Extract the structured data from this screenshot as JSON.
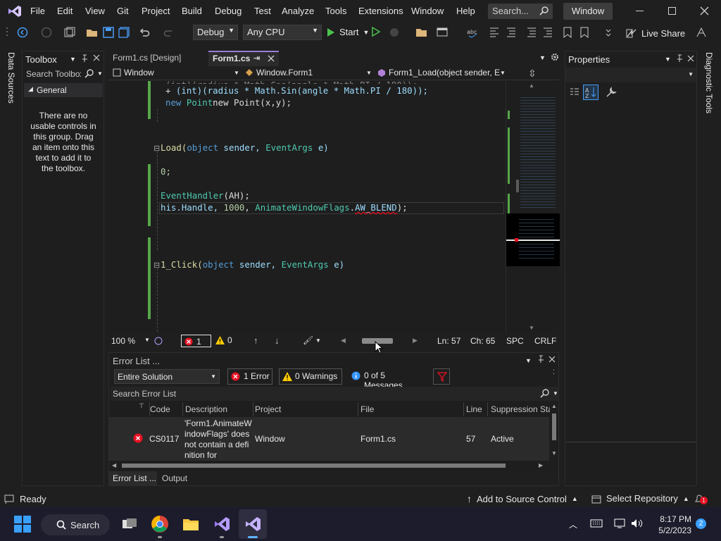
{
  "menu": [
    "File",
    "Edit",
    "View",
    "Git",
    "Project",
    "Build",
    "Debug",
    "Test",
    "Analyze",
    "Tools",
    "Extensions",
    "Window",
    "Help"
  ],
  "search": {
    "placeholder": "Search..."
  },
  "window_title": "Window",
  "toolbar": {
    "config": "Debug",
    "platform": "Any CPU",
    "start_label": "Start",
    "live_share": "Live Share"
  },
  "toolbox": {
    "title": "Toolbox",
    "search_placeholder": "Search Toolbox",
    "group": "General",
    "empty_text": "There are no usable controls in this group. Drag an item onto this text to add it to the toolbox."
  },
  "side_tabs": {
    "left": "Data Sources",
    "right": "Diagnostic Tools"
  },
  "tabs": [
    {
      "label": "Form1.cs [Design]"
    },
    {
      "label": "Form1.cs"
    }
  ],
  "nav": {
    "project": "Window",
    "class": "Window.Form1",
    "member": "Form1_Load(object sender, E"
  },
  "code": {
    "line1": "(int)(radius * Math.Sin(angle * Math.PI / 180));",
    "line2": "new Point(x,y);",
    "line3a": "Load(",
    "line3b": "object",
    "line3c": " sender, ",
    "line3d": "EventArgs",
    "line3e": " e)",
    "line4": "0;",
    "line5a": "EventHandler",
    "line5b": "(AH);",
    "line6a": "his.Handle, ",
    "line6b": "1000",
    "line6c": ", ",
    "line6d": "AnimateWindowFlags",
    "line6e": ".",
    "line6f": "AW_BLEND",
    "line6g": ");",
    "line7a": "1_Click(",
    "line7b": "object",
    "line7c": " sender, ",
    "line7d": "EventArgs",
    "line7e": " e)"
  },
  "status_editor": {
    "zoom": "100 %",
    "errors": "1",
    "warnings": "0",
    "ln": "Ln: 57",
    "ch": "Ch: 65",
    "spc": "SPC",
    "crlf": "CRLF"
  },
  "properties": {
    "title": "Properties"
  },
  "error_list": {
    "title": "Error List ...",
    "scope": "Entire Solution",
    "errors_btn": "1 Error",
    "warnings_btn": "0 Warnings",
    "messages_btn": "0 of 5 Messages",
    "search_placeholder": "Search Error List",
    "columns": [
      "Code",
      "Description",
      "Project",
      "File",
      "Line",
      "Suppression Sta"
    ],
    "row": {
      "code": "CS0117",
      "description": "'Form1.AnimateWindowFlags' does not contain a definition for",
      "project": "Window",
      "file": "Form1.cs",
      "line": "57",
      "suppression": "Active"
    },
    "bottom_tabs": [
      "Error List ...",
      "Output"
    ]
  },
  "statusbar": {
    "ready": "Ready",
    "source_control": "Add to Source Control",
    "repository": "Select Repository",
    "notifications": "1"
  },
  "taskbar": {
    "search": "Search",
    "time": "8:17 PM",
    "date": "5/2/2023",
    "badge": "2"
  },
  "colors": {
    "accent": "#68217a",
    "error": "#e81123",
    "warning": "#ffcc00",
    "taskbar": "#1c1c2c"
  }
}
